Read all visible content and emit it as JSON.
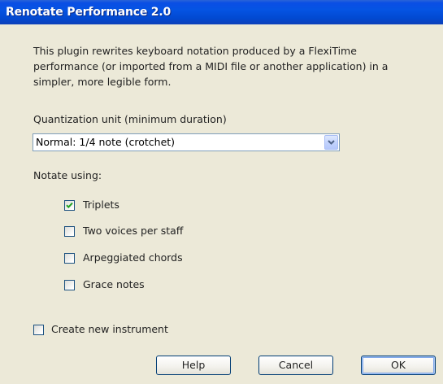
{
  "window": {
    "title": "Renotate Performance 2.0"
  },
  "description": "This plugin rewrites keyboard notation produced by a FlexiTime performance (or imported from a MIDI file or another application) in a simpler, more legible form.",
  "quantization": {
    "label": "Quantization unit (minimum duration)",
    "selected": "Normal: 1/4 note (crotchet)"
  },
  "notate": {
    "label": "Notate using:",
    "options": [
      {
        "label": "Triplets",
        "checked": true
      },
      {
        "label": "Two voices per staff",
        "checked": false
      },
      {
        "label": "Arpeggiated chords",
        "checked": false
      },
      {
        "label": "Grace notes",
        "checked": false
      }
    ]
  },
  "create_instrument": {
    "label": "Create new instrument",
    "checked": false
  },
  "buttons": {
    "help": "Help",
    "cancel": "Cancel",
    "ok": "OK"
  },
  "colors": {
    "titlebar": "#0554e3",
    "dialog_bg": "#ece9d8",
    "check_green": "#21a121"
  }
}
